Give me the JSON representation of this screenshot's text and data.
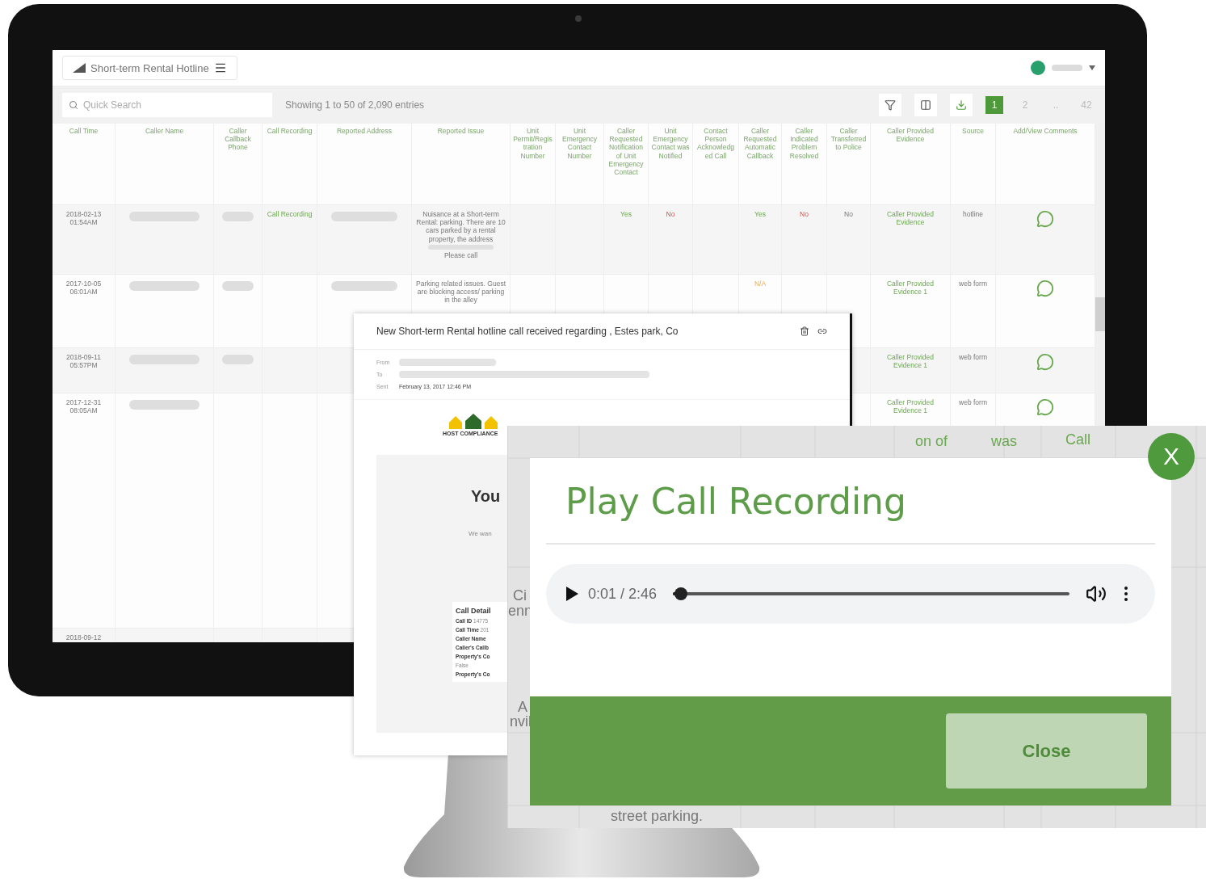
{
  "dashboard": {
    "title": "Short-term Rental Hotline",
    "search": {
      "placeholder": "Quick Search"
    },
    "entries_info": "Showing 1 to 50 of 2,090 entries",
    "pagination": [
      {
        "label": "1",
        "selected": true
      },
      {
        "label": "2",
        "selected": false
      },
      {
        "label": "..",
        "selected": false
      },
      {
        "label": "42",
        "selected": false
      }
    ],
    "table": {
      "columns": [
        "Call Time",
        "Caller Name",
        "Caller Callback Phone",
        "Call Recording",
        "Reported Address",
        "Reported Issue",
        "Unit Permit/Registration Number",
        "Unit Emergency Contact Number",
        "Caller Requested Notification of Unit Emergency Contact",
        "Unit Emergency Contact was Notified",
        "Contact Person Acknowledged Call",
        "Caller Requested Automatic Callback",
        "Caller Indicated Problem Resolved",
        "Caller Transferred to Police",
        "Caller Provided Evidence",
        "Source",
        "Add/View Comments"
      ],
      "rows": [
        {
          "cells": [
            {
              "kind": "text",
              "text": "2018-02-13 01:54AM"
            },
            {
              "kind": "blurred"
            },
            {
              "kind": "blurred"
            },
            {
              "kind": "link",
              "text": "Call Recording"
            },
            {
              "kind": "blurred"
            },
            {
              "kind": "redacted_issue",
              "text": "Nuisance at a Short-term Rental: parking. There are 10 cars parked by a rental property, the address",
              "tail": "Please call"
            },
            {
              "kind": "blank"
            },
            {
              "kind": "blank"
            },
            {
              "kind": "yes",
              "text": "Yes"
            },
            {
              "kind": "no",
              "text": "No"
            },
            {
              "kind": "blank"
            },
            {
              "kind": "yes",
              "text": "Yes"
            },
            {
              "kind": "no",
              "text": "No"
            },
            {
              "kind": "text",
              "text": "No"
            },
            {
              "kind": "link",
              "text": "Caller Provided Evidence"
            },
            {
              "kind": "text",
              "text": "hotline"
            },
            {
              "kind": "comment"
            }
          ]
        },
        {
          "cells": [
            {
              "kind": "text",
              "text": "2017-10-05 06:01AM"
            },
            {
              "kind": "blurred"
            },
            {
              "kind": "blurred"
            },
            {
              "kind": "blank"
            },
            {
              "kind": "blurred"
            },
            {
              "kind": "text",
              "text": "Parking related issues. Guest are blocking access/ parking in the alley"
            },
            {
              "kind": "blank"
            },
            {
              "kind": "blank"
            },
            {
              "kind": "blank"
            },
            {
              "kind": "blank"
            },
            {
              "kind": "blank"
            },
            {
              "kind": "na",
              "text": "N/A"
            },
            {
              "kind": "blank"
            },
            {
              "kind": "blank"
            },
            {
              "kind": "link",
              "text": "Caller Provided Evidence 1"
            },
            {
              "kind": "text",
              "text": "web form"
            },
            {
              "kind": "comment"
            }
          ]
        },
        {
          "cells": [
            {
              "kind": "text",
              "text": "2018-09-11 05:57PM"
            },
            {
              "kind": "blurred"
            },
            {
              "kind": "blurred"
            },
            {
              "kind": "blank"
            },
            {
              "kind": "blank"
            },
            {
              "kind": "blank"
            },
            {
              "kind": "blank"
            },
            {
              "kind": "blank"
            },
            {
              "kind": "blank"
            },
            {
              "kind": "blank"
            },
            {
              "kind": "blank"
            },
            {
              "kind": "blank"
            },
            {
              "kind": "blank"
            },
            {
              "kind": "blank"
            },
            {
              "kind": "link",
              "text": "Caller Provided Evidence 1"
            },
            {
              "kind": "text",
              "text": "web form"
            },
            {
              "kind": "comment"
            }
          ]
        },
        {
          "cells": [
            {
              "kind": "text",
              "text": "2017-12-31 08:05AM"
            },
            {
              "kind": "blurred"
            },
            {
              "kind": "blank"
            },
            {
              "kind": "blank"
            },
            {
              "kind": "blank"
            },
            {
              "kind": "blank"
            },
            {
              "kind": "blank"
            },
            {
              "kind": "blank"
            },
            {
              "kind": "blank"
            },
            {
              "kind": "blank"
            },
            {
              "kind": "blank"
            },
            {
              "kind": "blank"
            },
            {
              "kind": "blank"
            },
            {
              "kind": "blank"
            },
            {
              "kind": "link",
              "text": "Caller Provided Evidence 1"
            },
            {
              "kind": "text",
              "text": "web form"
            },
            {
              "kind": "comment"
            }
          ]
        },
        {
          "cells": [
            {
              "kind": "text",
              "text": "2018-09-12"
            },
            {
              "kind": "blank"
            },
            {
              "kind": "blank"
            },
            {
              "kind": "blank"
            },
            {
              "kind": "blank"
            },
            {
              "kind": "blank"
            },
            {
              "kind": "blank"
            },
            {
              "kind": "blank"
            },
            {
              "kind": "blank"
            },
            {
              "kind": "blank"
            },
            {
              "kind": "blank"
            },
            {
              "kind": "blank"
            },
            {
              "kind": "blank"
            },
            {
              "kind": "blank"
            },
            {
              "kind": "blank"
            },
            {
              "kind": "blank"
            },
            {
              "kind": "blank"
            }
          ]
        }
      ]
    }
  },
  "email": {
    "subject": "New Short-term Rental hotline call received regarding , Estes park, Co",
    "meta": [
      {
        "label": "From"
      },
      {
        "label": "To"
      },
      {
        "label": "Sent",
        "value": "February 13, 2017 12:46 PM"
      }
    ],
    "logo_text": "HOST COMPLIANCE",
    "heading": "You",
    "intro": "We wan",
    "details_title": "Call Detail",
    "details": [
      "**Call ID** 14775",
      "**Call Time** 201",
      "**Caller Name**",
      "**Caller's Callb**",
      "**Property's Co**",
      "False",
      "**Property's Co**"
    ]
  },
  "backdrop": {
    "fragments": [
      {
        "kind": "header",
        "text": "on of"
      },
      {
        "kind": "header",
        "text": "was"
      },
      {
        "kind": "header",
        "text": "Call"
      },
      {
        "kind": "text",
        "text": "Ci"
      },
      {
        "kind": "text",
        "text": "enn"
      },
      {
        "kind": "text",
        "text": "A"
      },
      {
        "kind": "text",
        "text": "nvil"
      },
      {
        "kind": "text",
        "text": "street parking."
      }
    ]
  },
  "recording_dialog": {
    "title": "Play Call Recording",
    "player": {
      "time": "0:01 / 2:46",
      "level": 0.02
    },
    "close_label": "Close",
    "dismiss_label": "X"
  }
}
